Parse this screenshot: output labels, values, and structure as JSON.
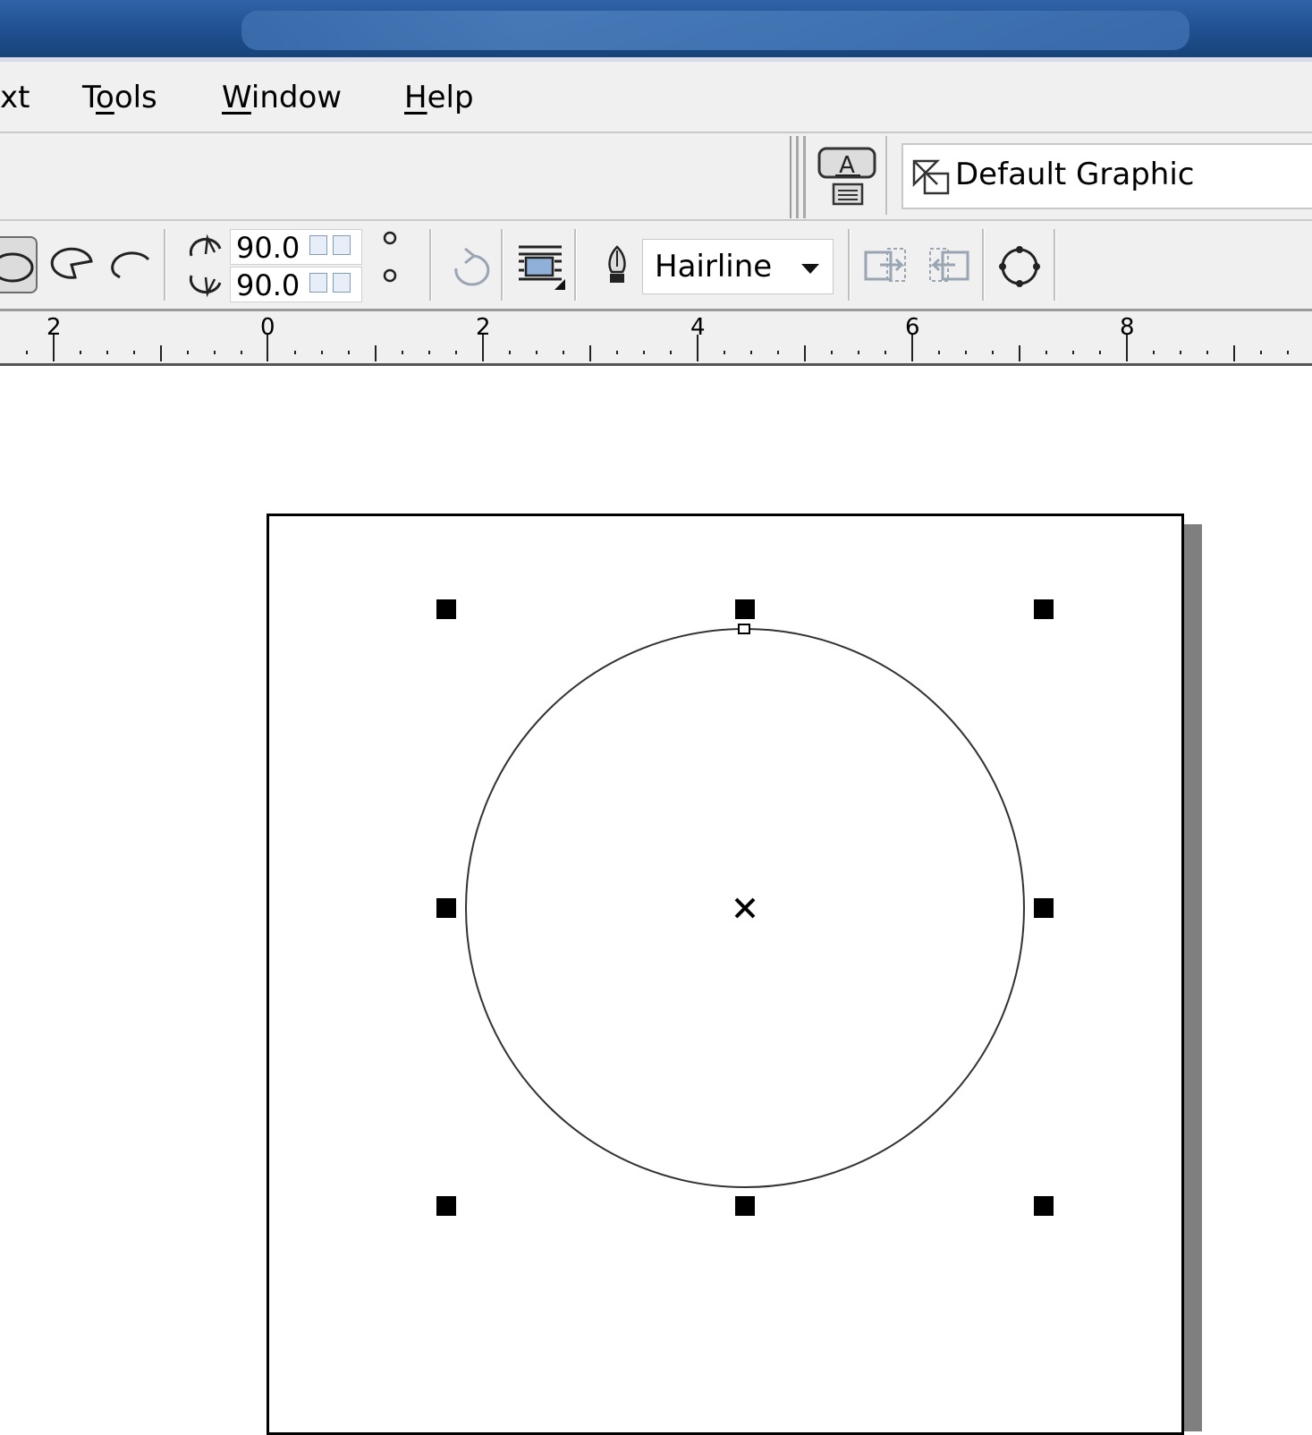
{
  "menu": {
    "items": [
      {
        "label_pre": "",
        "label_ul": "",
        "label_post": "xt"
      },
      {
        "label_pre": "T",
        "label_ul": "o",
        "label_post": "ols"
      },
      {
        "label_pre": "",
        "label_ul": "W",
        "label_post": "indow"
      },
      {
        "label_pre": "",
        "label_ul": "H",
        "label_post": "elp"
      }
    ]
  },
  "toolbar_styles": {
    "style_value": "Default Graphic"
  },
  "property_bar": {
    "start_angle": "90.0",
    "end_angle": "90.0",
    "outline_width": "Hairline"
  },
  "ruler": {
    "labels": [
      "2",
      "0",
      "2",
      "4",
      "6",
      "8"
    ]
  },
  "icons": [
    "ellipse-icon",
    "pie-icon",
    "arc-icon",
    "start-angle-icon",
    "end-angle-icon",
    "clockwise-radio-icon",
    "counterclockwise-radio-icon",
    "change-direction-icon",
    "wrap-text-icon",
    "outline-pen-icon",
    "dropdown-arrow-icon",
    "to-front-icon",
    "to-back-icon",
    "convert-to-curves-icon",
    "text-style-icon",
    "graphic-style-icon",
    "center-cross-icon"
  ]
}
